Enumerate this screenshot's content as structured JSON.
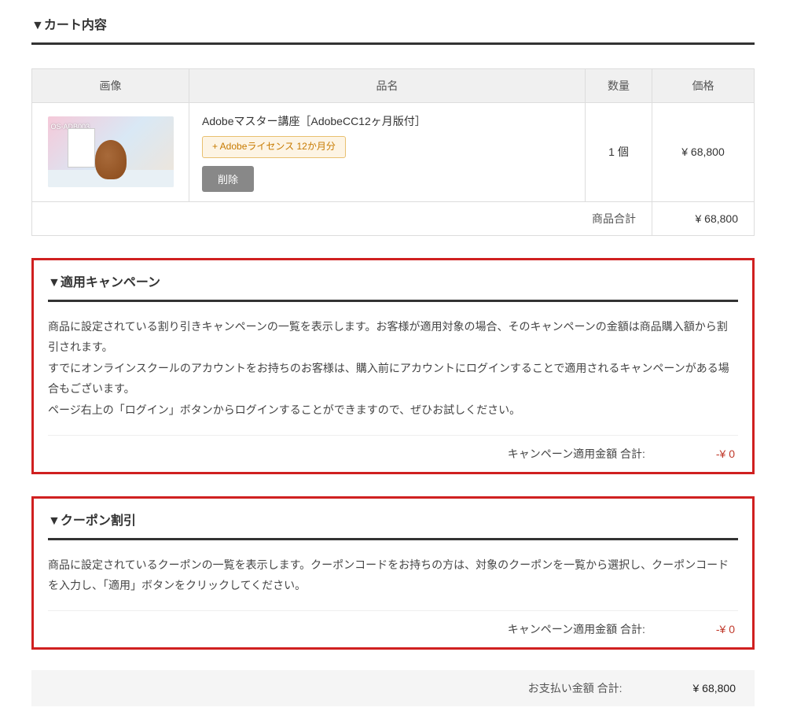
{
  "cart": {
    "title": "▼カート内容",
    "headers": {
      "image": "画像",
      "name": "品名",
      "qty": "数量",
      "price": "価格"
    },
    "item": {
      "thumb_code": "OS-ADB003",
      "name": "Adobeマスター講座［AdobeCC12ヶ月版付］",
      "license_badge": "+ Adobeライセンス 12か月分",
      "delete_label": "削除",
      "qty": "1 個",
      "price": "¥ 68,800"
    },
    "subtotal_label": "商品合計",
    "subtotal_value": "¥ 68,800"
  },
  "campaign": {
    "title": "▼適用キャンペーン",
    "desc": "商品に設定されている割り引きキャンペーンの一覧を表示します。お客様が適用対象の場合、そのキャンペーンの金額は商品購入額から割引されます。\nすでにオンラインスクールのアカウントをお持ちのお客様は、購入前にアカウントにログインすることで適用されるキャンペーンがある場合もございます。\nページ右上の「ログイン」ボタンからログインすることができますので、ぜひお試しください。",
    "amount_label": "キャンペーン適用金額 合計:",
    "amount_value": "-¥ 0"
  },
  "coupon": {
    "title": "▼クーポン割引",
    "desc": "商品に設定されているクーポンの一覧を表示します。クーポンコードをお持ちの方は、対象のクーポンを一覧から選択し、クーポンコードを入力し、「適用」ボタンをクリックしてください。",
    "amount_label": "キャンペーン適用金額 合計:",
    "amount_value": "-¥ 0"
  },
  "total": {
    "label": "お支払い金額 合計:",
    "value": "¥ 68,800"
  }
}
